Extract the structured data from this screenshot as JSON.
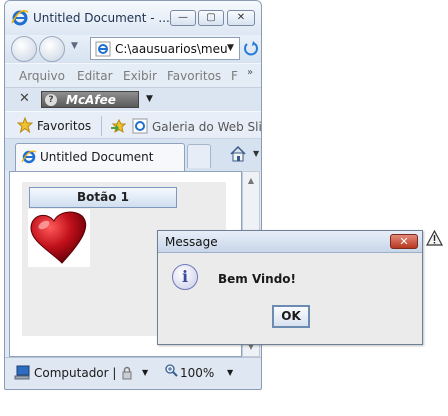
{
  "browser": {
    "title": "Untitled Document - ...",
    "window_buttons": {
      "minimize": "—",
      "maximize": "▢",
      "close": "✕"
    },
    "address": "C:\\aausuarios\\meu",
    "menu": [
      "Arquivo",
      "Editar",
      "Exibir",
      "Favoritos",
      "F"
    ],
    "menu_more": "»",
    "toolbar": {
      "close": "✕",
      "mcafee_label": "McAfee",
      "mcafee_glyph": "?"
    },
    "favorites": {
      "label": "Favoritos",
      "web_slice": "Galeria do Web Slic"
    },
    "tab_label": "Untitled Document",
    "status": {
      "zone": "Computador |",
      "zoom": "100%"
    },
    "scroll": {
      "up": "▲",
      "down": "▼"
    },
    "dropdown_glyph": "▼"
  },
  "page": {
    "button_label": "Botão 1"
  },
  "dialog": {
    "title": "Message",
    "close": "✕",
    "icon_glyph": "i",
    "message": "Bem Vindo!",
    "ok_label": "OK"
  },
  "colors": {
    "heart_red": "#c0101a",
    "ie_blue": "#1f6fd1",
    "dialog_close_red": "#b7371f"
  }
}
